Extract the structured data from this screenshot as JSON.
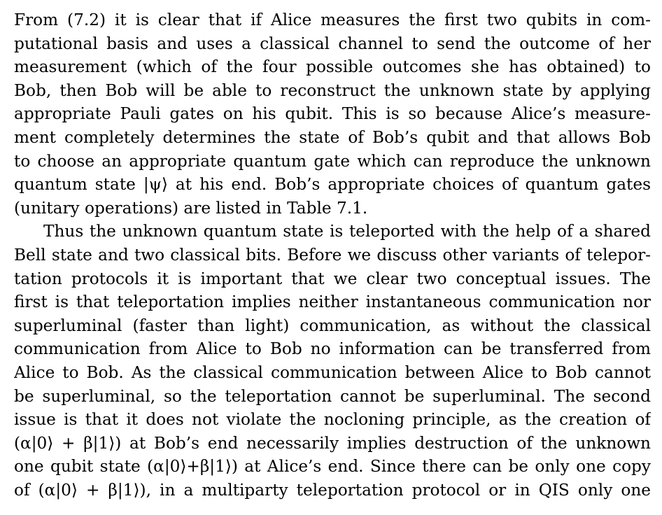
{
  "paragraphs": [
    {
      "indent": false,
      "lines": [
        "From (7.2) it is clear that if Alice measures the first two qubits in com-",
        "putational basis and uses a classical channel to send the outcome of her",
        "measurement (which of the four possible outcomes she has obtained) to",
        "Bob, then Bob will be able to reconstruct the unknown state by applying",
        "appropriate Pauli gates on his qubit.  This is so because Alice’s measure-",
        "ment completely determines the state of Bob’s qubit and that allows Bob",
        "to choose an appropriate quantum gate which can reproduce the unknown",
        "quantum state |ψ⟩ at his end. Bob’s appropriate choices of quantum gates",
        "(unitary operations) are listed in Table 7.1."
      ]
    },
    {
      "indent": true,
      "lines": [
        "Thus the unknown quantum state is teleported with the help of a shared",
        "Bell state and two classical bits. Before we discuss other variants of telepor-",
        "tation protocols it is important that we clear two conceptual issues.  The",
        "first is that teleportation implies neither instantaneous communication nor",
        "superluminal (faster than light) communication, as without the classical",
        "communication from Alice to Bob no information can be transferred from",
        "Alice to Bob. As the classical communication between Alice to Bob cannot",
        "be superluminal, so the teleportation cannot be superluminal. The second",
        "issue is that it does not violate the nocloning principle, as the creation of",
        "(α|0⟩ + β|1⟩) at Bob’s end necessarily implies destruction of the unknown",
        "one qubit state (α|0⟩+β|1⟩) at Alice’s end. Since there can be only one copy",
        "of (α|0⟩ + β|1⟩), in a multiparty teleportation protocol or in QIS only one"
      ]
    }
  ]
}
